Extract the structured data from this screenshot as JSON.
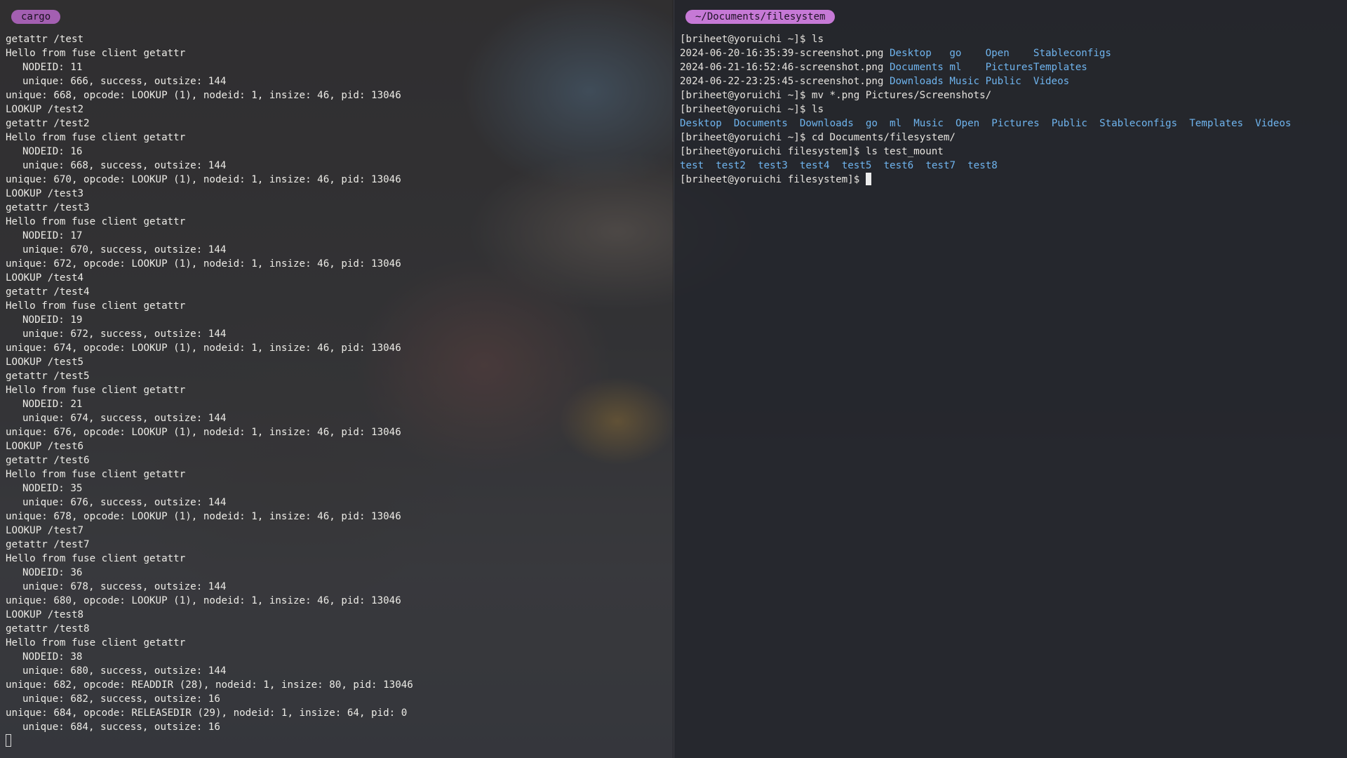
{
  "left_pane": {
    "tag": "cargo",
    "lines": [
      {
        "text": "getattr /test",
        "indent": false
      },
      {
        "text": "Hello from fuse client getattr",
        "indent": false
      },
      {
        "text": "NODEID: 11",
        "indent": true
      },
      {
        "text": "unique: 666, success, outsize: 144",
        "indent": true
      },
      {
        "text": "unique: 668, opcode: LOOKUP (1), nodeid: 1, insize: 46, pid: 13046",
        "indent": false
      },
      {
        "text": "LOOKUP /test2",
        "indent": false
      },
      {
        "text": "getattr /test2",
        "indent": false
      },
      {
        "text": "Hello from fuse client getattr",
        "indent": false
      },
      {
        "text": "NODEID: 16",
        "indent": true
      },
      {
        "text": "unique: 668, success, outsize: 144",
        "indent": true
      },
      {
        "text": "unique: 670, opcode: LOOKUP (1), nodeid: 1, insize: 46, pid: 13046",
        "indent": false
      },
      {
        "text": "LOOKUP /test3",
        "indent": false
      },
      {
        "text": "getattr /test3",
        "indent": false
      },
      {
        "text": "Hello from fuse client getattr",
        "indent": false
      },
      {
        "text": "NODEID: 17",
        "indent": true
      },
      {
        "text": "unique: 670, success, outsize: 144",
        "indent": true
      },
      {
        "text": "unique: 672, opcode: LOOKUP (1), nodeid: 1, insize: 46, pid: 13046",
        "indent": false
      },
      {
        "text": "LOOKUP /test4",
        "indent": false
      },
      {
        "text": "getattr /test4",
        "indent": false
      },
      {
        "text": "Hello from fuse client getattr",
        "indent": false
      },
      {
        "text": "NODEID: 19",
        "indent": true
      },
      {
        "text": "unique: 672, success, outsize: 144",
        "indent": true
      },
      {
        "text": "unique: 674, opcode: LOOKUP (1), nodeid: 1, insize: 46, pid: 13046",
        "indent": false
      },
      {
        "text": "LOOKUP /test5",
        "indent": false
      },
      {
        "text": "getattr /test5",
        "indent": false
      },
      {
        "text": "Hello from fuse client getattr",
        "indent": false
      },
      {
        "text": "NODEID: 21",
        "indent": true
      },
      {
        "text": "unique: 674, success, outsize: 144",
        "indent": true
      },
      {
        "text": "unique: 676, opcode: LOOKUP (1), nodeid: 1, insize: 46, pid: 13046",
        "indent": false
      },
      {
        "text": "LOOKUP /test6",
        "indent": false
      },
      {
        "text": "getattr /test6",
        "indent": false
      },
      {
        "text": "Hello from fuse client getattr",
        "indent": false
      },
      {
        "text": "NODEID: 35",
        "indent": true
      },
      {
        "text": "unique: 676, success, outsize: 144",
        "indent": true
      },
      {
        "text": "unique: 678, opcode: LOOKUP (1), nodeid: 1, insize: 46, pid: 13046",
        "indent": false
      },
      {
        "text": "LOOKUP /test7",
        "indent": false
      },
      {
        "text": "getattr /test7",
        "indent": false
      },
      {
        "text": "Hello from fuse client getattr",
        "indent": false
      },
      {
        "text": "NODEID: 36",
        "indent": true
      },
      {
        "text": "unique: 678, success, outsize: 144",
        "indent": true
      },
      {
        "text": "unique: 680, opcode: LOOKUP (1), nodeid: 1, insize: 46, pid: 13046",
        "indent": false
      },
      {
        "text": "LOOKUP /test8",
        "indent": false
      },
      {
        "text": "getattr /test8",
        "indent": false
      },
      {
        "text": "Hello from fuse client getattr",
        "indent": false
      },
      {
        "text": "NODEID: 38",
        "indent": true
      },
      {
        "text": "unique: 680, success, outsize: 144",
        "indent": true
      },
      {
        "text": "unique: 682, opcode: READDIR (28), nodeid: 1, insize: 80, pid: 13046",
        "indent": false
      },
      {
        "text": "unique: 682, success, outsize: 16",
        "indent": true
      },
      {
        "text": "unique: 684, opcode: RELEASEDIR (29), nodeid: 1, insize: 64, pid: 0",
        "indent": false
      },
      {
        "text": "unique: 684, success, outsize: 16",
        "indent": true
      }
    ]
  },
  "right_pane": {
    "tag": "~/Documents/filesystem",
    "prompt_home": "[briheet@yoruichi ~]$ ",
    "prompt_fs": "[briheet@yoruichi filesystem]$ ",
    "cmd_ls": "ls",
    "ls1_rows": [
      [
        "2024-06-20-16:35:39-screenshot.png",
        "Desktop",
        "go",
        "Open",
        "Stableconfigs"
      ],
      [
        "2024-06-21-16:52:46-screenshot.png",
        "Documents",
        "ml",
        "Pictures",
        "Templates"
      ],
      [
        "2024-06-22-23:25:45-screenshot.png",
        "Downloads",
        "Music",
        "Public",
        "Videos"
      ]
    ],
    "cmd_mv": "mv *.png Pictures/Screenshots/",
    "cmd_ls2": "ls",
    "ls2_items": [
      "Desktop",
      "Documents",
      "Downloads",
      "go",
      "ml",
      "Music",
      "Open",
      "Pictures",
      "Public",
      "Stableconfigs",
      "Templates",
      "Videos"
    ],
    "cmd_cd": "cd Documents/filesystem/",
    "cmd_ls_mount": "ls test_mount",
    "mount_items": [
      "test",
      "test2",
      "test3",
      "test4",
      "test5",
      "test6",
      "test7",
      "test8"
    ]
  },
  "colors": {
    "dir_blue": "#6fb4ee",
    "tag_left": "#a35fb1",
    "tag_right": "#c679d6"
  }
}
